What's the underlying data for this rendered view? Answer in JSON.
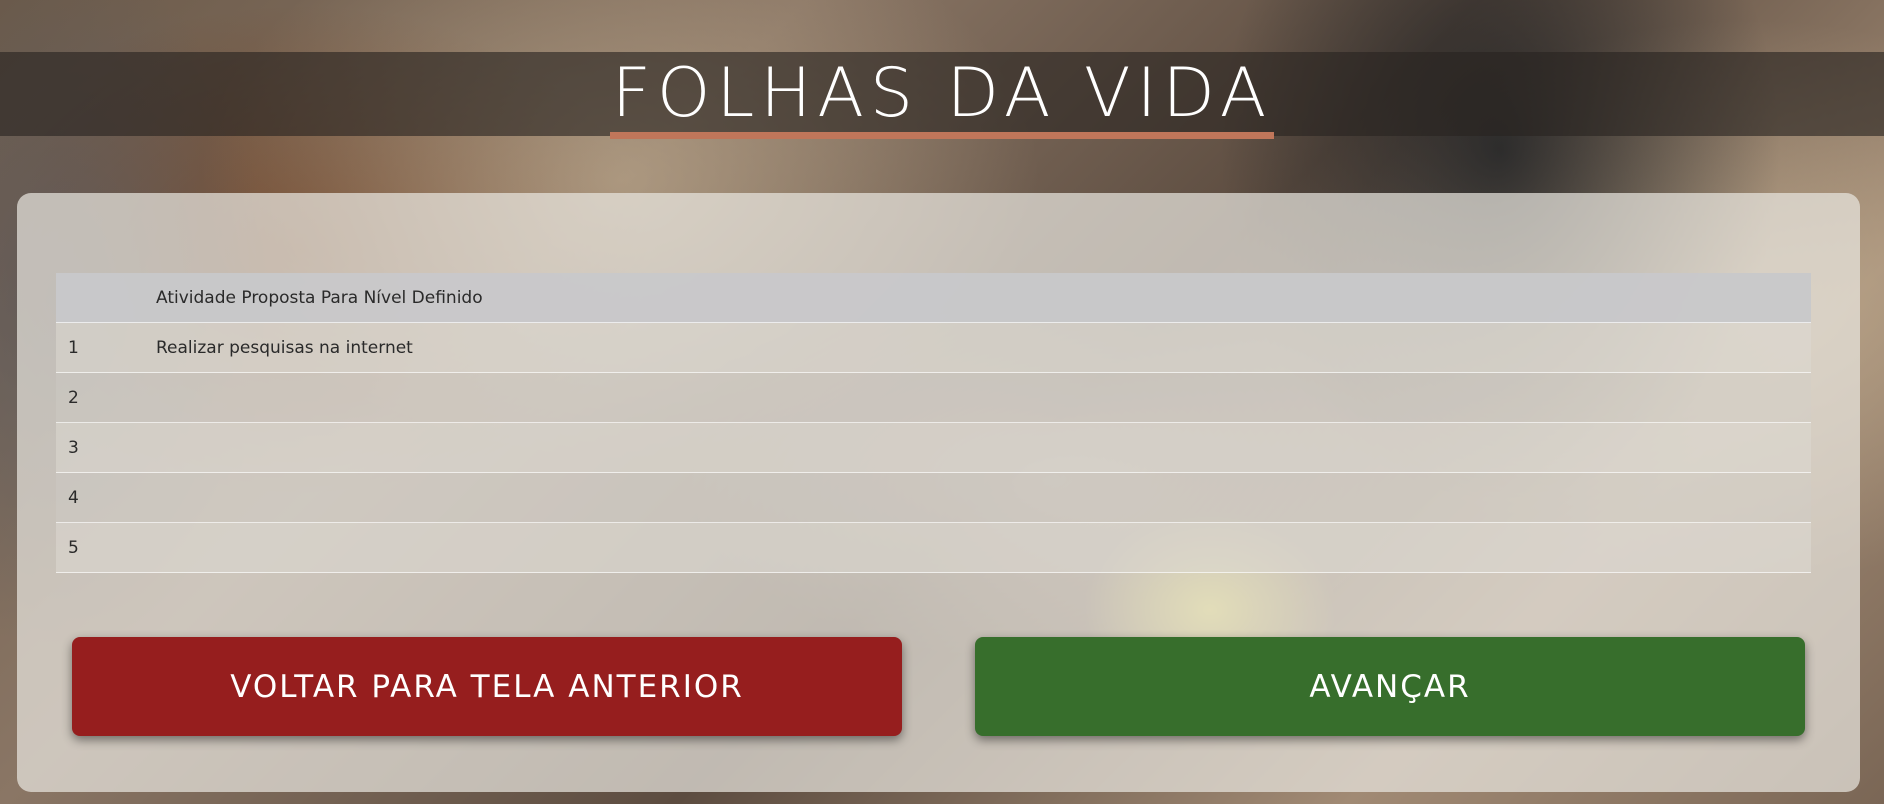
{
  "header": {
    "title": "FOLHAS DA VIDA"
  },
  "table": {
    "columns": [
      "",
      "Atividade Proposta Para Nível Definido"
    ],
    "rows": [
      {
        "num": "1",
        "activity": "Realizar pesquisas na internet"
      },
      {
        "num": "2",
        "activity": ""
      },
      {
        "num": "3",
        "activity": ""
      },
      {
        "num": "4",
        "activity": ""
      },
      {
        "num": "5",
        "activity": ""
      }
    ]
  },
  "buttons": {
    "back_label": "VOLTAR PARA TELA ANTERIOR",
    "next_label": "AVANÇAR"
  },
  "colors": {
    "back_button": "#961e1e",
    "next_button": "#376e2c",
    "title_underline": "#c0765a"
  }
}
